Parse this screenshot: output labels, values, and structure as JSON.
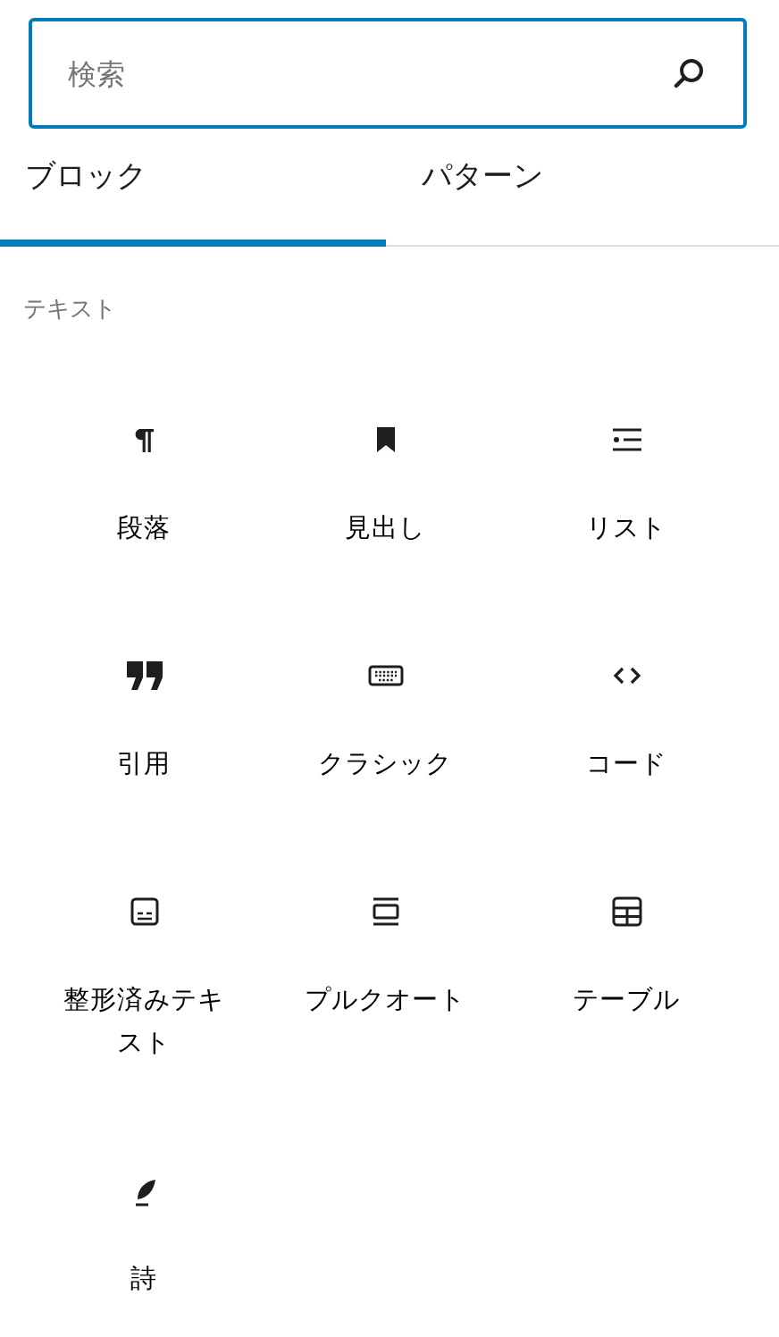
{
  "search": {
    "placeholder": "検索"
  },
  "tabs": [
    {
      "label": "ブロック",
      "selected": true
    },
    {
      "label": "パターン",
      "selected": false
    }
  ],
  "section": {
    "title": "テキスト"
  },
  "blocks": [
    {
      "kind": "paragraph",
      "label": "段落"
    },
    {
      "kind": "heading",
      "label": "見出し"
    },
    {
      "kind": "list",
      "label": "リスト"
    },
    {
      "kind": "quote",
      "label": "引用"
    },
    {
      "kind": "classic",
      "label": "クラシック"
    },
    {
      "kind": "code",
      "label": "コード"
    },
    {
      "kind": "preformatted",
      "label": "整形済みテキスト"
    },
    {
      "kind": "pullquote",
      "label": "プルクオート"
    },
    {
      "kind": "table",
      "label": "テーブル"
    },
    {
      "kind": "verse",
      "label": "詩"
    }
  ]
}
